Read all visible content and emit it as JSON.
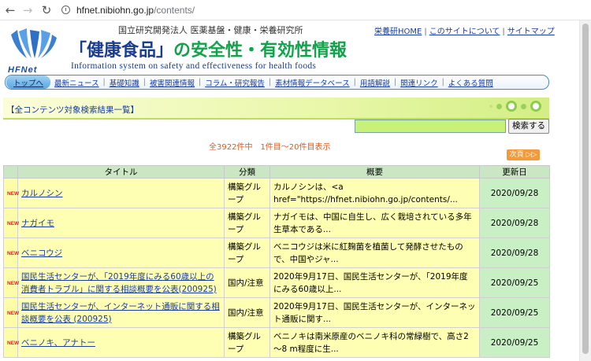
{
  "browser": {
    "url_host": "hfnet.nibiohn.go.jp",
    "url_path": "/contents/"
  },
  "header": {
    "logo_text": "HFNet",
    "org": "国立研究開発法人 医薬基盤・健康・栄養研究所",
    "title_part1": "「健康食品」",
    "title_part2": "の安全性・有効性情報",
    "subtitle": "Information system on safety and effectiveness for health foods",
    "top_links": [
      "栄養研HOME",
      "このサイトについて",
      "サイトマップ"
    ]
  },
  "nav": {
    "home": "トップへ",
    "items": [
      "最新ニュース",
      "基礎知識",
      "被害関連情報",
      "コラム・研究報告",
      "素材情報データベース",
      "用語解説",
      "関連リンク",
      "よくある質問"
    ]
  },
  "section": {
    "title": "【全コンテンツ対象検索結果一覧】"
  },
  "search": {
    "value": "",
    "button_label": "検索する"
  },
  "results_info": {
    "text": "全3922件中　1件目～20件目表示",
    "next_label": "次頁 ▷▷"
  },
  "table": {
    "headers": [
      "",
      "タイトル",
      "分類",
      "概要",
      "更新日"
    ],
    "new_label": "NEW",
    "rows": [
      {
        "title": "カルノシン",
        "category": "構築グループ",
        "summary": "カルノシンは、<a href=\"https://hfnet.nibiohn.go.jp/contents/...",
        "date": "2020/09/28"
      },
      {
        "title": "ナガイモ",
        "category": "構築グループ",
        "summary": "ナガイモは、中国に自生し、広く栽培されている多年生草本である...",
        "date": "2020/09/28"
      },
      {
        "title": "ベニコウジ",
        "category": "構築グループ",
        "summary": "ベニコウジは米に紅麹菌を植菌して発酵させたもので、中国やジャ...",
        "date": "2020/09/28"
      },
      {
        "title": "国民生活センターが、「2019年度にみる60歳以上の消費者トラブル」に関する相談概要を公表(200925)",
        "category": "国内/注意",
        "summary": "2020年9月17日、国民生活センターが、「2019年度にみる60歳以上...",
        "date": "2020/09/25"
      },
      {
        "title": "国民生活センターが、インターネット通販に関する相談概要を公表 (200925)",
        "category": "国内/注意",
        "summary": "2020年9月17日、国民生活センターが、インターネット通販に関す...",
        "date": "2020/09/25"
      },
      {
        "title": "ベニノキ、アナトー",
        "category": "構築グループ",
        "summary": "ベニノキは南米原産のベニノキ科の常緑樹で、高さ2～8 m程度に生...",
        "date": "2020/09/25"
      }
    ]
  },
  "colors": {
    "link": "#1a3da0",
    "title_blue": "#1a3d8f",
    "title_green": "#11a34a",
    "row_yellow": "#ffffb3",
    "date_green": "#c9f0c5",
    "accent_orange": "#e05a1e"
  }
}
